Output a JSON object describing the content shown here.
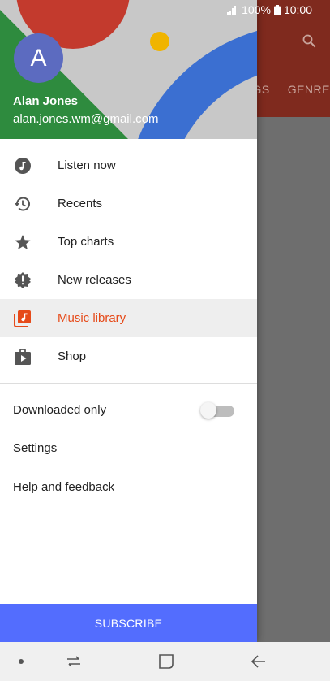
{
  "status": {
    "battery_percent": "100%",
    "time": "10:00"
  },
  "background_app": {
    "tabs": [
      "GS",
      "GENRE"
    ]
  },
  "account": {
    "avatar_letter": "A",
    "name": "Alan Jones",
    "email": "alan.jones.wm@gmail.com"
  },
  "menu": [
    {
      "label": "Listen now",
      "icon": "music-note-icon"
    },
    {
      "label": "Recents",
      "icon": "history-icon"
    },
    {
      "label": "Top charts",
      "icon": "star-icon"
    },
    {
      "label": "New releases",
      "icon": "new-releases-icon"
    },
    {
      "label": "Music library",
      "icon": "library-music-icon",
      "active": true
    },
    {
      "label": "Shop",
      "icon": "shop-icon"
    }
  ],
  "secondary": {
    "downloaded_only": "Downloaded only",
    "downloaded_only_enabled": false,
    "settings": "Settings",
    "help": "Help and feedback"
  },
  "subscribe_label": "SUBSCRIBE",
  "colors": {
    "accent": "#e64a19",
    "subscribe": "#536dfe",
    "avatar": "#5c6bc0"
  }
}
